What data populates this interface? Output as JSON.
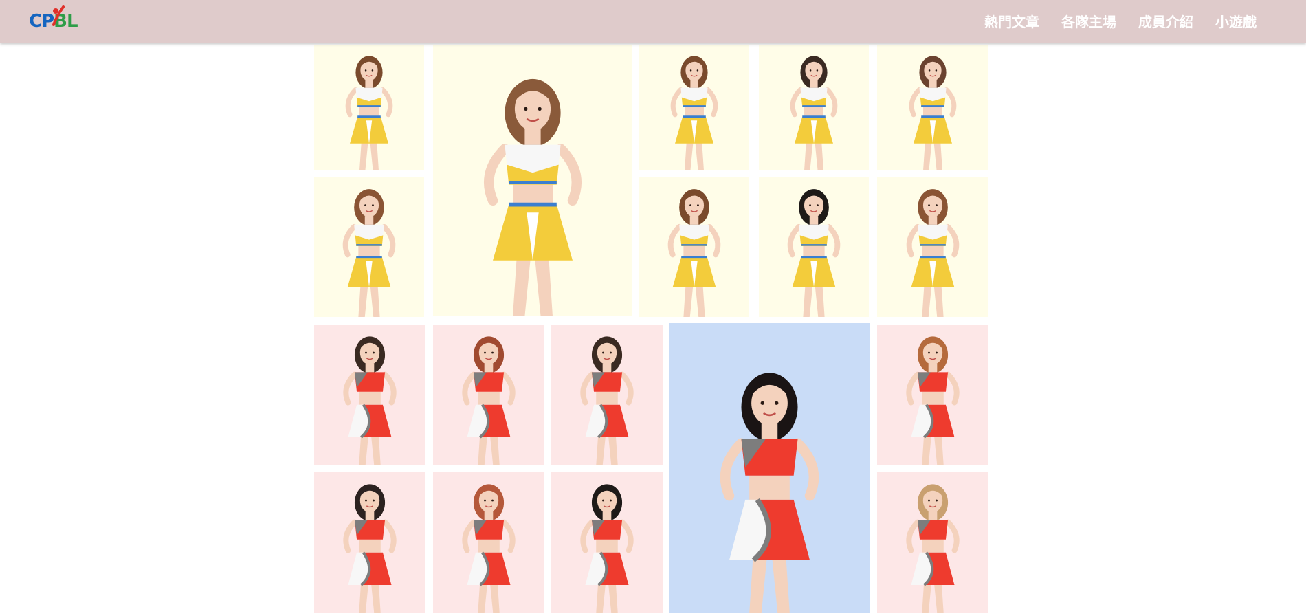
{
  "navbar": {
    "logo": {
      "part1": "CP",
      "part2": "BL",
      "logo_icon": "baseball-bat-icon"
    },
    "menu": [
      {
        "label": "熱門文章"
      },
      {
        "label": "各隊主場"
      },
      {
        "label": "成員介紹"
      },
      {
        "label": "小遊戲"
      }
    ]
  },
  "colors": {
    "navbar_bg": "#dfcbcb",
    "yellow_tile_bg": "#fffde8",
    "pink_tile_bg": "#fde7e7",
    "blue_tile_bg": "#c9dcf7",
    "yellow_uniform": "#f3cc3b",
    "red_uniform": "#ee3b2e",
    "white_uniform": "#f7f7f7"
  },
  "gallery": {
    "sections": [
      {
        "name": "yellow-team",
        "uniform": "yellow-white",
        "member_count": 9,
        "featured": true
      },
      {
        "name": "red-team",
        "uniform": "red-grey-white",
        "member_count": 10,
        "featured": true
      }
    ]
  }
}
